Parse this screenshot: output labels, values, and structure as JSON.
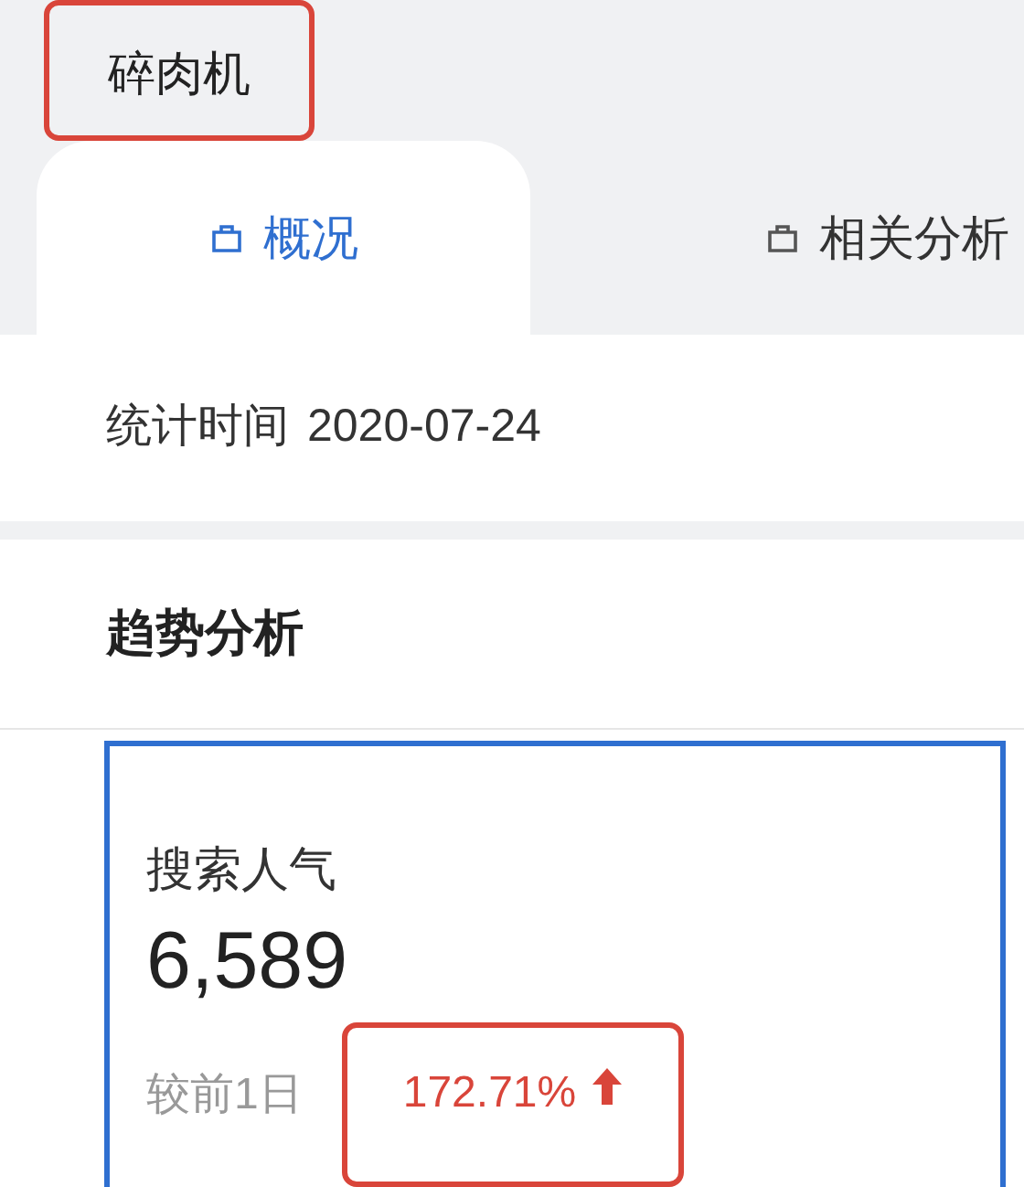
{
  "header": {
    "title": "碎肉机",
    "highlighted": true
  },
  "tabs": [
    {
      "label": "概况",
      "selected": true
    },
    {
      "label": "相关分析",
      "selected": false
    }
  ],
  "stat_time": {
    "label": "统计时间",
    "value": "2020-07-24"
  },
  "trend": {
    "title": "趋势分析",
    "card": {
      "label": "搜索人气",
      "value": "6,589",
      "compare_label": "较前1日",
      "change": "172.71%",
      "rising": true,
      "highlighted": true
    }
  }
}
